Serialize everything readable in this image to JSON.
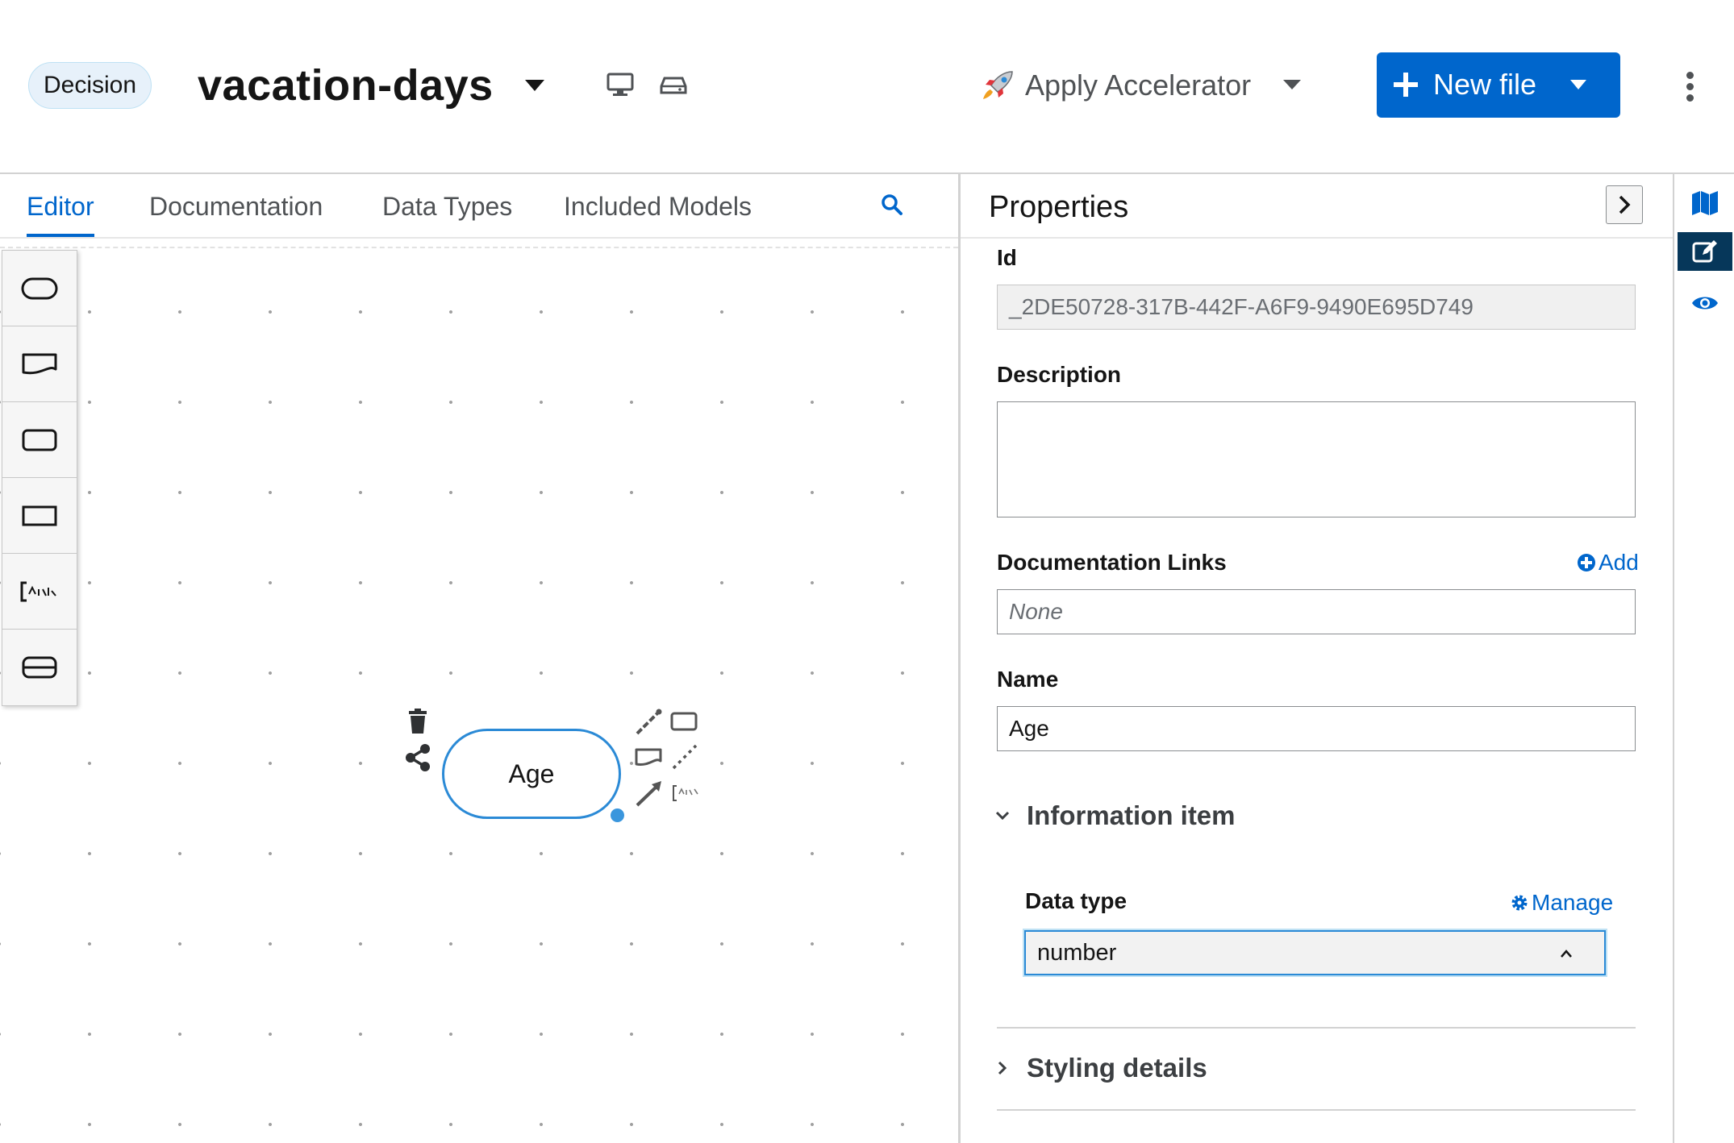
{
  "header": {
    "badge": "Decision",
    "file_name": "vacation-days",
    "accelerator_label": "Apply Accelerator",
    "new_file_label": "New file"
  },
  "tabs": [
    {
      "label": "Editor",
      "active": true
    },
    {
      "label": "Documentation",
      "active": false
    },
    {
      "label": "Data Types",
      "active": false
    },
    {
      "label": "Included Models",
      "active": false
    }
  ],
  "palette": [
    "decision",
    "input-data",
    "knowledge-source",
    "business-knowledge-model",
    "text-annotation",
    "decision-service"
  ],
  "canvas": {
    "node_label": "Age",
    "toolbox": [
      "delete-icon",
      "share-icon",
      "connector-icon",
      "decision-icon",
      "knowledge-source-icon",
      "association-icon",
      "arrow-icon",
      "annotation-icon"
    ]
  },
  "properties": {
    "title": "Properties",
    "id_label": "Id",
    "id_value": "_2DE50728-317B-442F-A6F9-9490E695D749",
    "description_label": "Description",
    "description_value": "",
    "doc_links_label": "Documentation Links",
    "add_label": "Add",
    "doc_links_placeholder": "None",
    "name_label": "Name",
    "name_value": "Age",
    "info_section": "Information item",
    "data_type_label": "Data type",
    "manage_label": "Manage",
    "data_type_value": "number",
    "styling_section": "Styling details"
  },
  "colors": {
    "accent": "#0066cc",
    "node_border": "#2b8ad6",
    "rail_active": "#06375a"
  }
}
